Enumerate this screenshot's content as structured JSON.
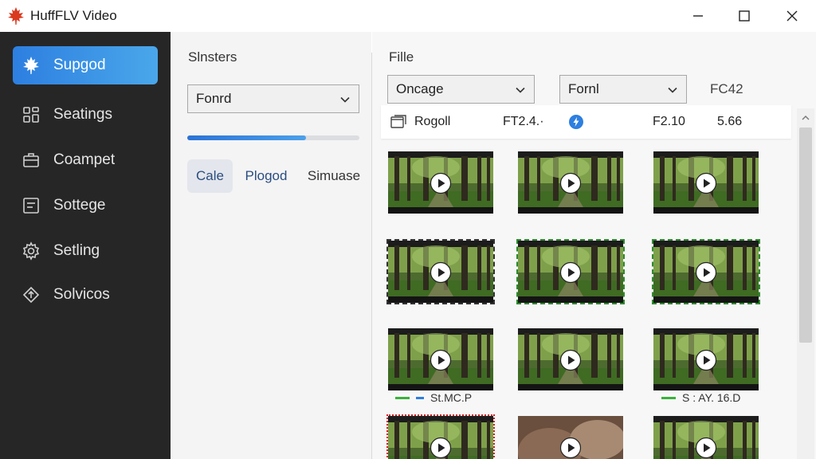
{
  "window": {
    "title": "HuffFLV Video",
    "logo_icon": "maple-leaf-icon",
    "controls": [
      "minimize-icon",
      "maximize-icon",
      "close-icon"
    ]
  },
  "sidebar": {
    "items": [
      {
        "label": "Supgod",
        "icon": "maple-leaf-icon",
        "active": true
      },
      {
        "label": "Seatings",
        "icon": "grid-icon",
        "active": false
      },
      {
        "label": "Coampet",
        "icon": "briefcase-icon",
        "active": false
      },
      {
        "label": "Sottege",
        "icon": "document-icon",
        "active": false
      },
      {
        "label": "Setling",
        "icon": "gear-icon",
        "active": false
      },
      {
        "label": "Solvicos",
        "icon": "diamond-arrow-icon",
        "active": false
      }
    ]
  },
  "settings_panel": {
    "title": "Slnsters",
    "dropdown_value": "Fonrd",
    "progress": 0.69,
    "tabs": [
      {
        "label": "Cale",
        "active": true
      },
      {
        "label": "Plogod",
        "active": false
      },
      {
        "label": "Simuase",
        "active": false
      }
    ]
  },
  "file_panel": {
    "title": "Fille",
    "dropdown1_value": "Oncage",
    "dropdown2_value": "Fornl",
    "format_label": "FC42",
    "info_row": {
      "name": "Rogoll",
      "value1": "FT2.4.·",
      "value2": "F2.10",
      "value3": "5.66"
    },
    "captions": [
      "St.MC.P",
      "S : AY. 16.D"
    ]
  },
  "colors": {
    "accent": "#2d7fe0",
    "sidebar_bg": "#262626",
    "selection_green": "#2e8b2e",
    "selection_red": "#d32020",
    "logo_red": "#d93a1f"
  }
}
